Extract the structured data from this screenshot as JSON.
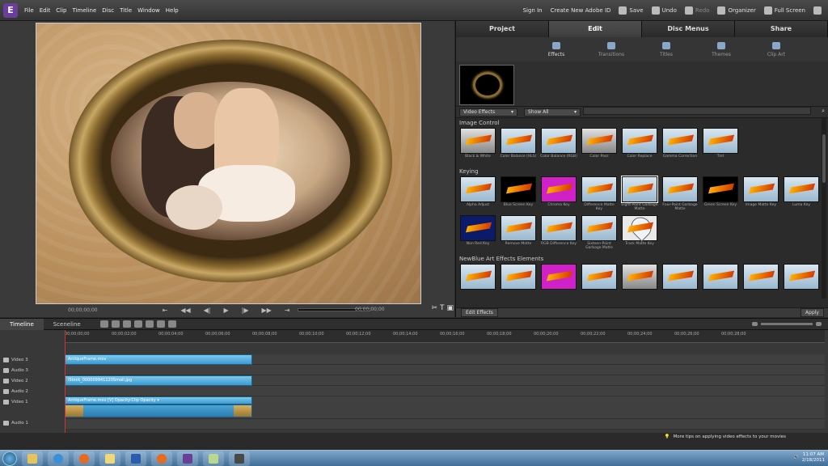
{
  "menubar": {
    "items": [
      "File",
      "Edit",
      "Clip",
      "Timeline",
      "Disc",
      "Title",
      "Window",
      "Help"
    ],
    "sign_in": "Sign In",
    "create_id": "Create New Adobe ID",
    "save": "Save",
    "undo": "Undo",
    "redo": "Redo",
    "organizer": "Organizer",
    "full_screen": "Full Screen"
  },
  "monitor": {
    "timecode_left": "00;00;00;00",
    "timecode_right": "00;00;00;00"
  },
  "panel": {
    "tabs": [
      "Project",
      "Edit",
      "Disc Menus",
      "Share"
    ],
    "subtabs": [
      "Effects",
      "Transitions",
      "Titles",
      "Themes",
      "Clip Art"
    ],
    "filter_select": "Video Effects",
    "show_select": "Show All",
    "categories": [
      {
        "name": "Image Control",
        "effects": [
          "Black & White",
          "Color Balance (HLS)",
          "Color Balance (RGB)",
          "Color Pass",
          "Color Replace",
          "Gamma Correction",
          "Tint"
        ]
      },
      {
        "name": "Keying",
        "effects": [
          "Alpha Adjust",
          "Blue Screen Key",
          "Chroma Key",
          "Difference Matte Key",
          "Eight-Point Garbage Matte",
          "Four-Point Garbage Matte",
          "Green Screen Key",
          "Image Matte Key",
          "Luma Key",
          "Non Red Key",
          "Remove Matte",
          "RGB Difference Key",
          "Sixteen-Point Garbage Matte",
          "Track Matte Key"
        ]
      },
      {
        "name": "NewBlue Art Effects Elements",
        "effects": []
      }
    ],
    "edit_effects": "Edit Effects",
    "apply": "Apply"
  },
  "timeline": {
    "tabs": [
      "Timeline",
      "Sceneline"
    ],
    "ticks": [
      "00;00;00;00",
      "00;00;02;00",
      "00;00;04;00",
      "00;00;06;00",
      "00;00;08;00",
      "00;00;10;00",
      "00;00;12;00",
      "00;00;14;00",
      "00;00;16;00",
      "00;00;18;00",
      "00;00;20;00",
      "00;00;22;00",
      "00;00;24;00",
      "00;00;26;00",
      "00;00;28;00"
    ],
    "tracks": [
      "Video 3",
      "Audio 3",
      "Video 2",
      "Audio 2",
      "Video 1",
      "Audio 1"
    ],
    "clip_v3": "AntiqueFrame.mov",
    "clip_v2": "iStock_000009941120Small.jpg",
    "clip_v1": "AntiqueFrame.mov [V]  Opacity:Clip Opacity ▾",
    "tip": "More tips on applying video effects to your movies"
  },
  "taskbar": {
    "time": "11:07 AM",
    "date": "2/18/2011"
  }
}
